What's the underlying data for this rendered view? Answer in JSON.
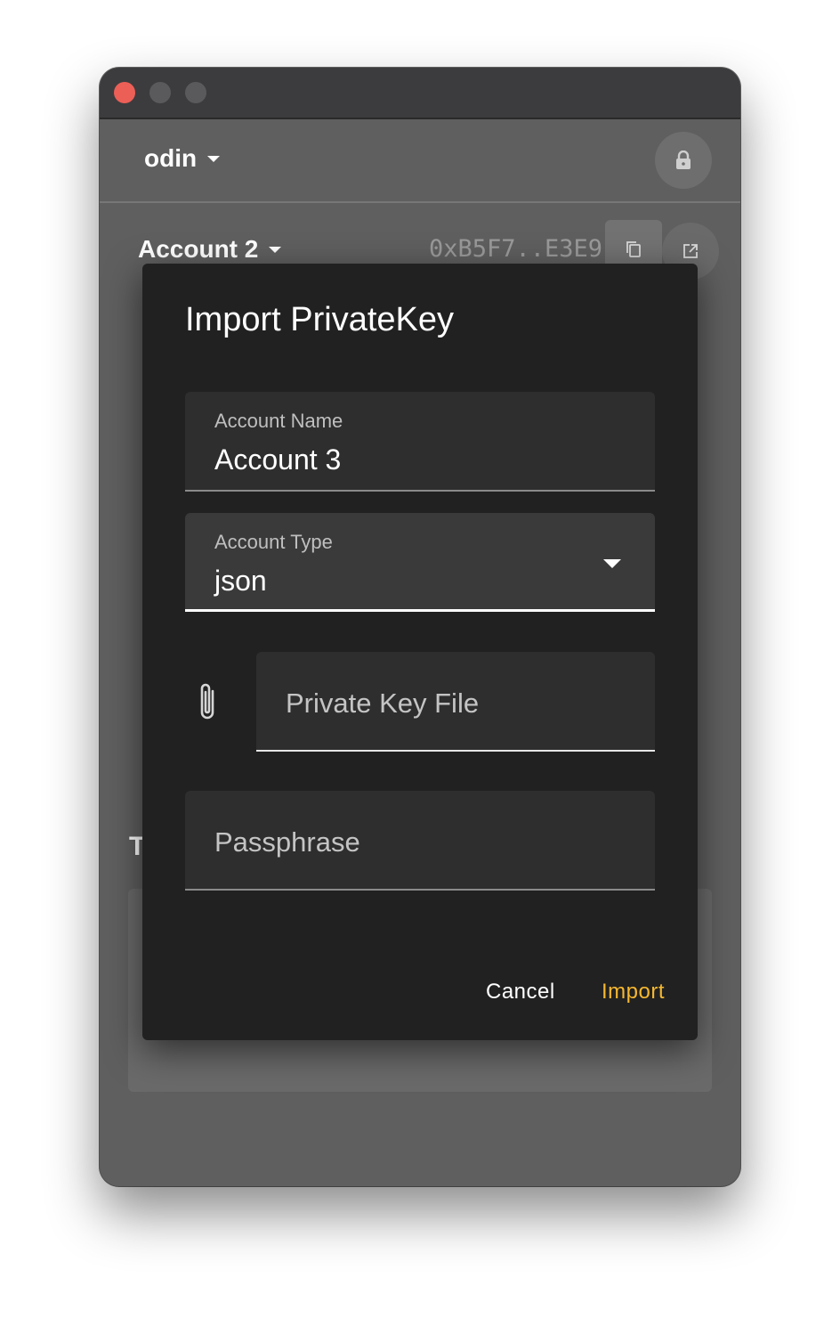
{
  "header": {
    "network_name": "odin"
  },
  "account": {
    "name": "Account 2",
    "address": "0xB5F7..E3E9"
  },
  "background": {
    "section_heading_partial": "T"
  },
  "dialog": {
    "title": "Import PrivateKey",
    "account_name": {
      "label": "Account Name",
      "value": "Account 3"
    },
    "account_type": {
      "label": "Account Type",
      "value": "json"
    },
    "private_key_file": {
      "placeholder": "Private Key File"
    },
    "passphrase": {
      "placeholder": "Passphrase"
    },
    "cancel_label": "Cancel",
    "import_label": "Import"
  },
  "colors": {
    "accent": "#f5b731",
    "dialog_bg": "#212121",
    "window_bg": "#5f5f5f",
    "close_light": "#ec5f57"
  },
  "icons": [
    "lock-icon",
    "copy-icon",
    "open-external-icon",
    "paperclip-icon",
    "chevron-down-icon"
  ]
}
